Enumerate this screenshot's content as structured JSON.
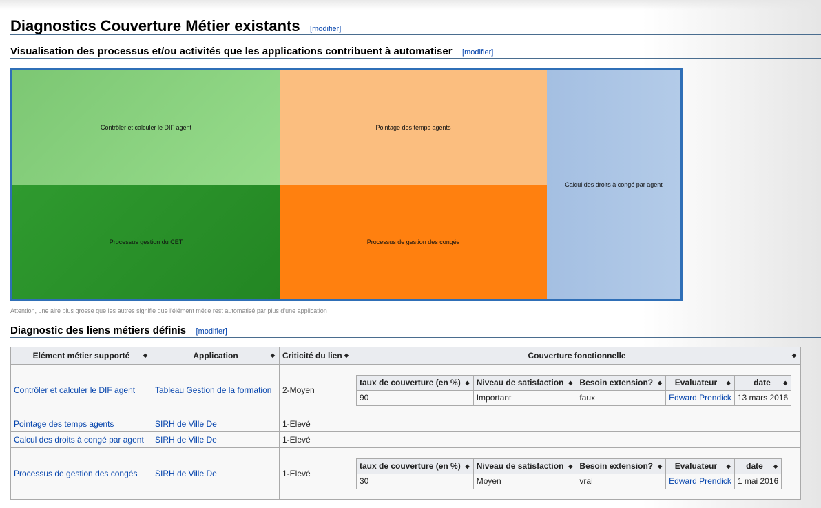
{
  "section_title": "Diagnostics Couverture Métier existants",
  "edit_label": "[modifier]",
  "viz_title": "Visualisation des processus et/ou activités que les applications contribuent à automatiser",
  "treemap": [
    {
      "label": "Contrôler et calculer le DIF agent",
      "color": "#8fd683"
    },
    {
      "label": "Processus gestion du CET",
      "color": "#2a8f2a"
    },
    {
      "label": "Pointage des temps agents",
      "color": "#fbbe7f"
    },
    {
      "label": "Processus de gestion des congés",
      "color": "#ff7f0e"
    },
    {
      "label": "Calcul des droits à congé par agent",
      "color": "#a8c2e2"
    }
  ],
  "caption": "Attention, une aire plus grosse que les autres signifie que l'élément métie rest automatisé par plus d'une application",
  "links_title": "Diagnostic des liens métiers définis",
  "table": {
    "headers": [
      "Elément métier supporté",
      "Application",
      "Criticité du lien",
      "Couverture fonctionnelle"
    ],
    "inner_headers": [
      "taux de couverture (en %)",
      "Niveau de satisfaction",
      "Besoin extension?",
      "Evaluateur",
      "date"
    ],
    "rows": [
      {
        "element": "Contrôler et calculer le DIF agent",
        "application": "Tableau Gestion de la formation",
        "criticite": "2-Moyen",
        "coverage": {
          "taux": "90",
          "niveau": "Important",
          "besoin": "faux",
          "evaluateur": "Edward Prendick",
          "date": "13 mars 2016"
        }
      },
      {
        "element": "Pointage des temps agents",
        "application": "SIRH de Ville De",
        "criticite": "1-Elevé"
      },
      {
        "element": "Calcul des droits à congé par agent",
        "application": "SIRH de Ville De",
        "criticite": "1-Elevé"
      },
      {
        "element": "Processus de gestion des congés",
        "application": "SIRH de Ville De",
        "criticite": "1-Elevé",
        "coverage": {
          "taux": "30",
          "niveau": "Moyen",
          "besoin": "vrai",
          "evaluateur": "Edward Prendick",
          "date": "1 mai 2016"
        }
      }
    ]
  }
}
